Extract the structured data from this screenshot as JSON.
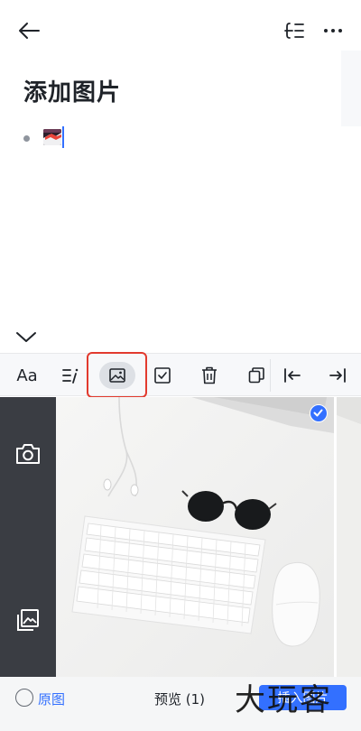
{
  "header": {
    "back_icon": "arrow-left-icon",
    "outline_icon": "outline-icon",
    "more_icon": "more-horizontal-icon"
  },
  "document": {
    "title": "添加图片",
    "list_items": [
      {
        "type": "image-thumbnail"
      }
    ]
  },
  "toolbar": {
    "items": [
      {
        "label": "Aa",
        "icon": "text-format"
      },
      {
        "icon": "list-format-icon"
      },
      {
        "icon": "image-icon",
        "active": true
      },
      {
        "icon": "checkbox-icon"
      },
      {
        "icon": "trash-icon"
      },
      {
        "icon": "copy-icon"
      },
      {
        "icon": "outdent-icon"
      },
      {
        "icon": "indent-icon"
      }
    ],
    "highlight_color": "#e23a2e"
  },
  "picker": {
    "sources": [
      {
        "icon": "camera-icon"
      },
      {
        "icon": "gallery-icon"
      }
    ],
    "photos": [
      {
        "selected": true
      },
      {
        "selected": false
      }
    ]
  },
  "bottom_bar": {
    "original_label": "原图",
    "preview_label": "预览 (1)",
    "insert_label": "插入图片"
  },
  "watermark": "大玩客",
  "colors": {
    "accent": "#3370ff",
    "sidebar": "#3a3d43",
    "toolbar_bg": "#f7f8fa"
  }
}
